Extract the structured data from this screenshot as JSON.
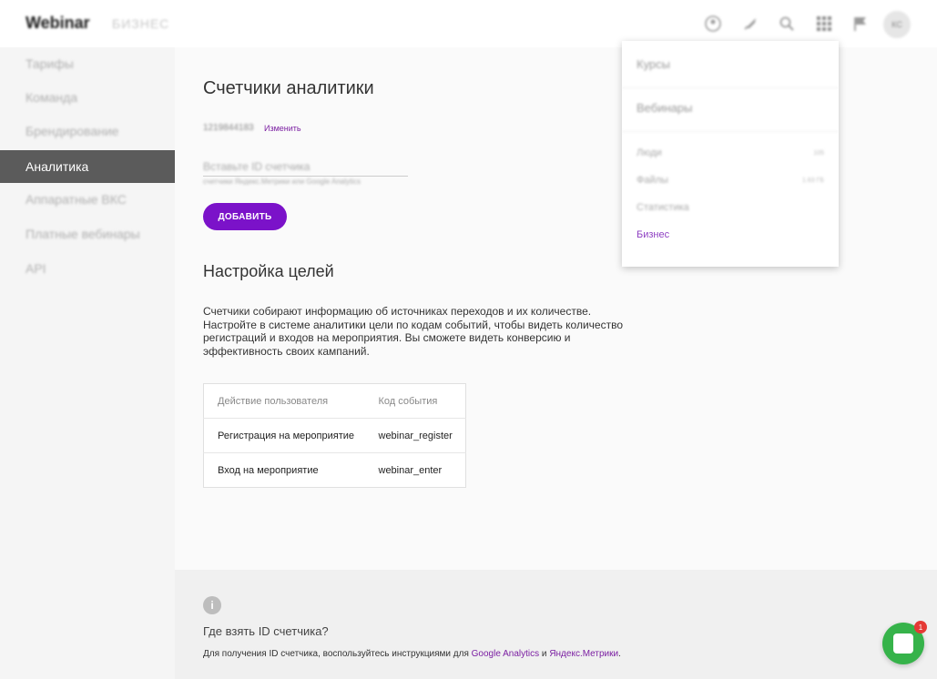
{
  "header": {
    "logo": "Webinar",
    "logo_sub": "БИЗНЕС",
    "avatar_initials": "КС",
    "icons": [
      "user-circle-icon",
      "rocket-icon",
      "search-icon",
      "apps-grid-icon",
      "flag-icon"
    ]
  },
  "sidebar": {
    "items": [
      {
        "label": "Тарифы"
      },
      {
        "label": "Команда"
      },
      {
        "label": "Брендирование"
      },
      {
        "label": "Аналитика",
        "active": true
      },
      {
        "label": "Аппаратные ВКС"
      },
      {
        "label": "Платные вебинары"
      },
      {
        "label": "API"
      }
    ]
  },
  "analytics": {
    "title": "Счетчики аналитики",
    "counter_id": "1219844183",
    "change_label": "Изменить",
    "input_placeholder": "Вставьте ID счетчика",
    "input_hint": "счетчики Яндекс.Метрики или Google Analytics",
    "add_button": "ДОБАВИТЬ"
  },
  "goals": {
    "title": "Настройка целей",
    "description": "Счетчики собирают информацию об источниках переходов и их количестве. Настройте в системе аналитики цели по кодам событий, чтобы видеть количество регистраций и входов на мероприятия. Вы сможете видеть конверсию и эффективность своих кампаний.",
    "table": {
      "headers": [
        "Действие пользователя",
        "Код события"
      ],
      "rows": [
        [
          "Регистрация на мероприятие",
          "webinar_register"
        ],
        [
          "Вход на мероприятие",
          "webinar_enter"
        ]
      ]
    }
  },
  "footer": {
    "info_icon": "i",
    "title": "Где взять ID счетчика?",
    "text_before": "Для получения ID счетчика, воспользуйтесь инструкциями для ",
    "link_ga": "Google Analytics",
    "text_mid": " и ",
    "link_ym": "Яндекс.Метрики",
    "text_end": "."
  },
  "dropdown": {
    "main_items": [
      "Курсы",
      "Вебинары"
    ],
    "sub_items": [
      {
        "label": "Люди",
        "count": "105"
      },
      {
        "label": "Файлы",
        "count": "1.63 ГБ"
      },
      {
        "label": "Статистика",
        "count": ""
      }
    ],
    "business_label": "Бизнес"
  },
  "chat": {
    "badge": "1",
    "accent": "#36b34a"
  },
  "colors": {
    "accent": "#7b12c9",
    "link": "#7b1fa2",
    "sidebar_active": "#5b5b5b"
  }
}
